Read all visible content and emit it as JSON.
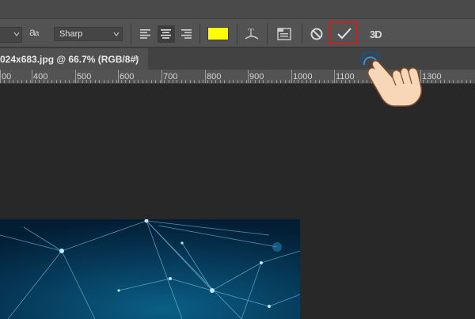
{
  "options_bar": {
    "antialias_label_big": "a",
    "antialias_label_small": "a",
    "antialias_value": "Sharp",
    "text_color": "#ffff00",
    "three_d_label": "3D"
  },
  "tab": {
    "title": "024x683.jpg @ 66.7% (RGB/8#)",
    "close_symbol": "×"
  },
  "ruler": {
    "labels": [
      "00",
      "400",
      "500",
      "600",
      "700",
      "800",
      "900",
      "1000",
      "1100",
      "1300"
    ]
  },
  "colors": {
    "commit_highlight": "#cc1f1f",
    "workspace": "#282828"
  }
}
